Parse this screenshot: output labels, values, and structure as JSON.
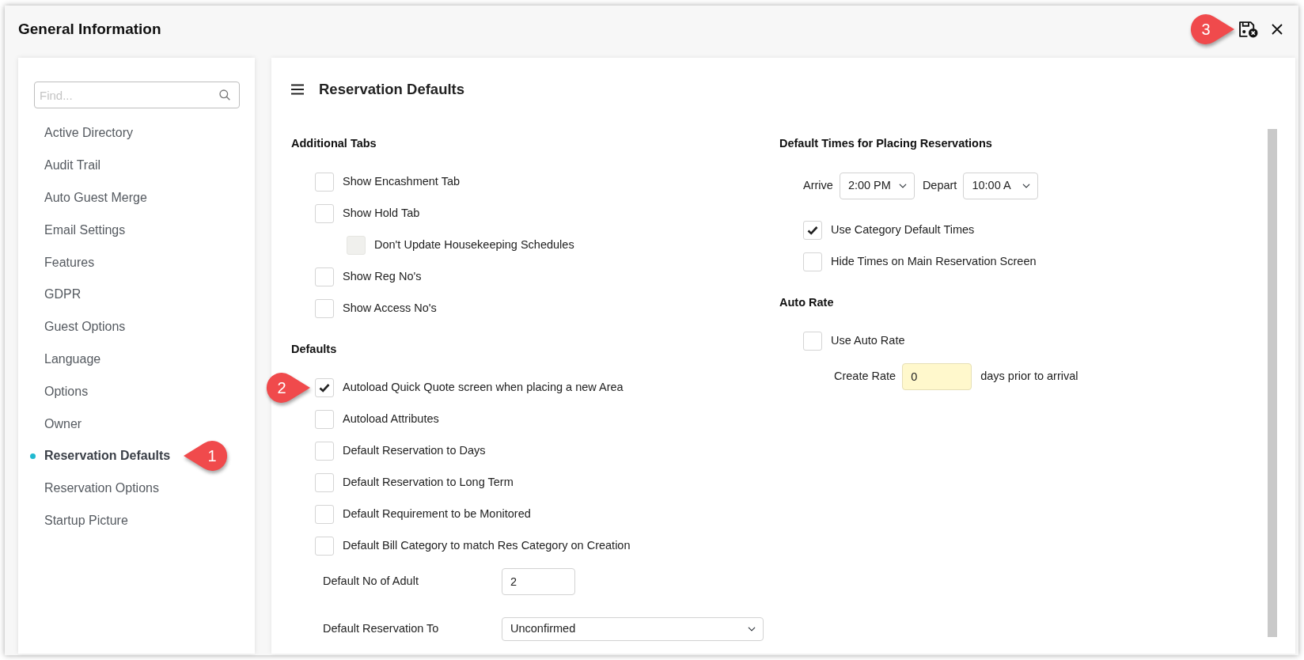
{
  "window": {
    "title": "General Information",
    "buttons": [
      {
        "kind": "save",
        "callout": "3"
      },
      {
        "kind": "close"
      }
    ]
  },
  "sidebar": {
    "search": {
      "placeholder": "Find..."
    },
    "items": [
      {
        "label": "Active Directory",
        "selected": false
      },
      {
        "label": "Audit Trail",
        "selected": false
      },
      {
        "label": "Auto Guest Merge",
        "selected": false
      },
      {
        "label": "Email Settings",
        "selected": false
      },
      {
        "label": "Features",
        "selected": false
      },
      {
        "label": "GDPR",
        "selected": false
      },
      {
        "label": "Guest Options",
        "selected": false
      },
      {
        "label": "Language",
        "selected": false
      },
      {
        "label": "Options",
        "selected": false
      },
      {
        "label": "Owner",
        "selected": false
      },
      {
        "label": "Reservation Defaults",
        "selected": true,
        "callout": "1"
      },
      {
        "label": "Reservation Options",
        "selected": false
      },
      {
        "label": "Startup Picture",
        "selected": false
      }
    ]
  },
  "panel": {
    "title": "Reservation Defaults",
    "columns": [
      {
        "sections": [
          {
            "title": "Additional Tabs",
            "items": [
              {
                "kind": "checkbox",
                "label": "Show Encashment Tab",
                "checked": false,
                "disabled": false
              },
              {
                "kind": "checkbox",
                "label": "Show Hold Tab",
                "checked": false,
                "disabled": false,
                "children": [
                  {
                    "kind": "checkbox",
                    "label": "Don't Update Housekeeping Schedules",
                    "checked": false,
                    "disabled": true
                  }
                ]
              },
              {
                "kind": "checkbox",
                "label": "Show Reg No's",
                "checked": false,
                "disabled": false
              },
              {
                "kind": "checkbox",
                "label": "Show Access No's",
                "checked": false,
                "disabled": false
              }
            ]
          },
          {
            "title": "Defaults",
            "items": [
              {
                "kind": "checkbox",
                "label": "Autoload Quick Quote screen when placing a new Area",
                "checked": true,
                "disabled": false,
                "callout": "2"
              },
              {
                "kind": "checkbox",
                "label": "Autoload Attributes",
                "checked": false,
                "disabled": false
              },
              {
                "kind": "checkbox",
                "label": "Default Reservation to Days",
                "checked": false,
                "disabled": false
              },
              {
                "kind": "checkbox",
                "label": "Default Reservation to Long Term",
                "checked": false,
                "disabled": false
              },
              {
                "kind": "checkbox",
                "label": "Default Requirement to be Monitored",
                "checked": false,
                "disabled": false
              },
              {
                "kind": "checkbox",
                "label": "Default Bill Category to match Res Category on Creation",
                "checked": false,
                "disabled": false
              },
              {
                "kind": "input",
                "label": "Default No of Adult",
                "value": "2"
              },
              {
                "kind": "select",
                "label": "Default Reservation To",
                "value": "Unconfirmed"
              }
            ]
          }
        ]
      },
      {
        "sections": [
          {
            "title": "Default Times for Placing Reservations",
            "items": [
              {
                "kind": "select_pair",
                "fields": [
                  {
                    "label": "Arrive",
                    "value": "2:00 PM"
                  },
                  {
                    "label": "Depart",
                    "value": "10:00 A"
                  }
                ]
              },
              {
                "kind": "checkbox",
                "label": "Use Category Default Times",
                "checked": true,
                "disabled": false
              },
              {
                "kind": "checkbox",
                "label": "Hide Times on Main Reservation Screen",
                "checked": false,
                "disabled": false
              }
            ]
          },
          {
            "title": "Auto Rate",
            "items": [
              {
                "kind": "checkbox",
                "label": "Use Auto Rate",
                "checked": false,
                "disabled": false
              },
              {
                "kind": "rate_input",
                "label": "Create Rate",
                "value": "0",
                "suffix": "days prior to arrival"
              }
            ]
          }
        ]
      }
    ]
  }
}
